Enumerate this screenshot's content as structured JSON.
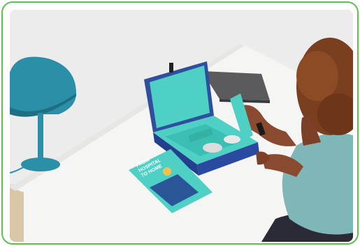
{
  "photo": {
    "alt_hint": "",
    "booklet": {
      "line1": "FROM",
      "line2": "HOSPITAL",
      "line3": "TO HOME"
    }
  },
  "colors": {
    "border": "#5ec24a",
    "wall": "#ededed",
    "desk": "#f4f4f2",
    "lamp": "#2b8fa8",
    "box_teal": "#4fd0c4",
    "box_navy": "#23408f",
    "shirt": "#7fb7b9",
    "skin": "#8a4a30",
    "hair": "#7a3f1f"
  }
}
